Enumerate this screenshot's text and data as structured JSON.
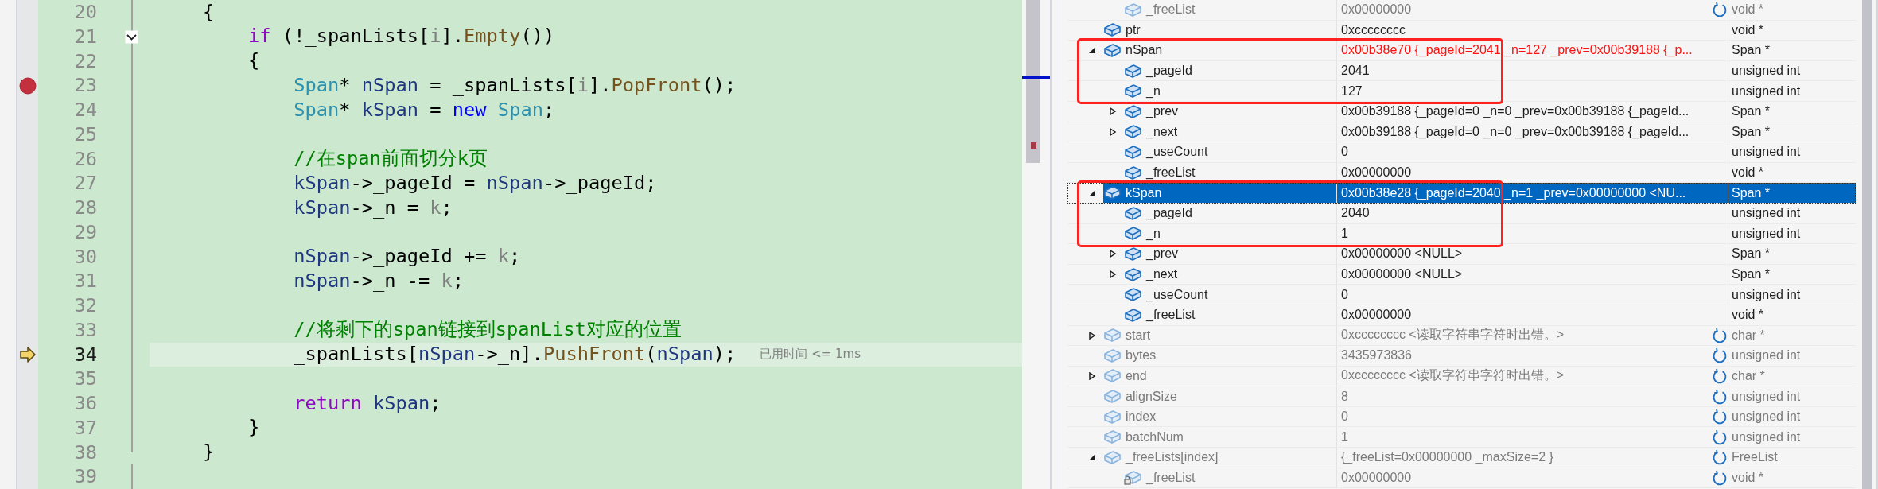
{
  "editor": {
    "lines": [
      {
        "number": "20",
        "breakpoint": false,
        "current": false,
        "foldable": false,
        "tokens": [
          {
            "text": "    {",
            "kind": "plain"
          }
        ]
      },
      {
        "number": "21",
        "breakpoint": false,
        "current": false,
        "foldable": true,
        "tokens": [
          {
            "text": "        if",
            "kind": "keyword"
          },
          {
            "text": " (!_spanLists[",
            "kind": "plain"
          },
          {
            "text": "i",
            "kind": "param"
          },
          {
            "text": "].",
            "kind": "plain"
          },
          {
            "text": "Empty",
            "kind": "function"
          },
          {
            "text": "())",
            "kind": "plain"
          }
        ]
      },
      {
        "number": "22",
        "breakpoint": false,
        "current": false,
        "foldable": false,
        "tokens": [
          {
            "text": "        {",
            "kind": "plain"
          }
        ]
      },
      {
        "number": "23",
        "breakpoint": true,
        "current": false,
        "foldable": false,
        "tokens": [
          {
            "text": "            Span",
            "kind": "type"
          },
          {
            "text": "* ",
            "kind": "plain"
          },
          {
            "text": "nSpan",
            "kind": "local"
          },
          {
            "text": " = _spanLists[",
            "kind": "plain"
          },
          {
            "text": "i",
            "kind": "param"
          },
          {
            "text": "].",
            "kind": "plain"
          },
          {
            "text": "PopFront",
            "kind": "function"
          },
          {
            "text": "();",
            "kind": "plain"
          }
        ]
      },
      {
        "number": "24",
        "breakpoint": false,
        "current": false,
        "foldable": false,
        "tokens": [
          {
            "text": "            Span",
            "kind": "type"
          },
          {
            "text": "* ",
            "kind": "plain"
          },
          {
            "text": "kSpan",
            "kind": "local"
          },
          {
            "text": " = ",
            "kind": "plain"
          },
          {
            "text": "new",
            "kind": "operator-keyword"
          },
          {
            "text": " Span",
            "kind": "type"
          },
          {
            "text": ";",
            "kind": "plain"
          }
        ]
      },
      {
        "number": "25",
        "breakpoint": false,
        "current": false,
        "foldable": false
      },
      {
        "number": "26",
        "breakpoint": false,
        "current": false,
        "foldable": false,
        "tokens": [
          {
            "text": "            //在span前面切分k页",
            "kind": "comment"
          }
        ]
      },
      {
        "number": "27",
        "breakpoint": false,
        "current": false,
        "foldable": false,
        "tokens": [
          {
            "text": "            kSpan",
            "kind": "local"
          },
          {
            "text": "->_pageId = ",
            "kind": "plain"
          },
          {
            "text": "nSpan",
            "kind": "local"
          },
          {
            "text": "->_pageId;",
            "kind": "plain"
          }
        ]
      },
      {
        "number": "28",
        "breakpoint": false,
        "current": false,
        "foldable": false,
        "tokens": [
          {
            "text": "            kSpan",
            "kind": "local"
          },
          {
            "text": "->_n = ",
            "kind": "plain"
          },
          {
            "text": "k",
            "kind": "param"
          },
          {
            "text": ";",
            "kind": "plain"
          }
        ]
      },
      {
        "number": "29",
        "breakpoint": false,
        "current": false,
        "foldable": false
      },
      {
        "number": "30",
        "breakpoint": false,
        "current": false,
        "foldable": false,
        "tokens": [
          {
            "text": "            nSpan",
            "kind": "local"
          },
          {
            "text": "->_pageId += ",
            "kind": "plain"
          },
          {
            "text": "k",
            "kind": "param"
          },
          {
            "text": ";",
            "kind": "plain"
          }
        ]
      },
      {
        "number": "31",
        "breakpoint": false,
        "current": false,
        "foldable": false,
        "tokens": [
          {
            "text": "            nSpan",
            "kind": "local"
          },
          {
            "text": "->_n -= ",
            "kind": "plain"
          },
          {
            "text": "k",
            "kind": "param"
          },
          {
            "text": ";",
            "kind": "plain"
          }
        ]
      },
      {
        "number": "32",
        "breakpoint": false,
        "current": false,
        "foldable": false
      },
      {
        "number": "33",
        "breakpoint": false,
        "current": false,
        "foldable": false,
        "tokens": [
          {
            "text": "            //将剩下的span链接到spanList对应的位置",
            "kind": "comment"
          }
        ]
      },
      {
        "number": "34",
        "breakpoint": false,
        "current": true,
        "foldable": false,
        "hint": "已用时间 <= 1ms",
        "tokens": [
          {
            "text": "            _spanLists[",
            "kind": "plain"
          },
          {
            "text": "nSpan",
            "kind": "local"
          },
          {
            "text": "->_n].",
            "kind": "plain"
          },
          {
            "text": "PushFront",
            "kind": "function"
          },
          {
            "text": "(",
            "kind": "plain"
          },
          {
            "text": "nSpan",
            "kind": "local"
          },
          {
            "text": ");",
            "kind": "plain"
          }
        ]
      },
      {
        "number": "35",
        "breakpoint": false,
        "current": false,
        "foldable": false
      },
      {
        "number": "36",
        "breakpoint": false,
        "current": false,
        "foldable": false,
        "tokens": [
          {
            "text": "            return",
            "kind": "keyword"
          },
          {
            "text": " kSpan",
            "kind": "local"
          },
          {
            "text": ";",
            "kind": "plain"
          }
        ]
      },
      {
        "number": "37",
        "breakpoint": false,
        "current": false,
        "foldable": false,
        "tokens": [
          {
            "text": "        }",
            "kind": "plain"
          }
        ]
      },
      {
        "number": "38",
        "breakpoint": false,
        "current": false,
        "foldable": false,
        "tokens": [
          {
            "text": "    }",
            "kind": "plain"
          }
        ]
      },
      {
        "number": "39",
        "breakpoint": false,
        "current": false,
        "foldable": false
      }
    ]
  },
  "watch": {
    "continued": [
      {
        "name": "_freeList",
        "value": "0x00000000",
        "type": "void *",
        "kind": "member",
        "expandable": false,
        "selected": false,
        "stale": true,
        "changed": false,
        "boxed": false
      }
    ],
    "rows": [
      {
        "name": "ptr",
        "value": "0xcccccccc",
        "type": "void *",
        "kind": "member",
        "expandable": false,
        "selected": false,
        "stale": false,
        "changed": false,
        "boxed": false
      },
      {
        "name": "nSpan",
        "value": "0x00b38e70 {_pageId=2041 _n=127 _prev=0x00b39188 {_p...",
        "type": "Span *",
        "kind": "member",
        "expandable": true,
        "expanded": true,
        "selected": false,
        "stale": false,
        "changed": true,
        "boxed": true,
        "children": [
          {
            "name": "_pageId",
            "value": "2041",
            "type": "unsigned int",
            "kind": "member",
            "expandable": false,
            "selected": false,
            "stale": false,
            "changed": false,
            "boxed": true
          },
          {
            "name": "_n",
            "value": "127",
            "type": "unsigned int",
            "kind": "member",
            "expandable": false,
            "selected": false,
            "stale": false,
            "changed": false,
            "boxed": true
          },
          {
            "name": "_prev",
            "value": "0x00b39188 {_pageId=0 _n=0 _prev=0x00b39188 {_pageId...",
            "type": "Span *",
            "kind": "member",
            "expandable": true,
            "expanded": false,
            "selected": false,
            "stale": false,
            "changed": false,
            "boxed": false
          },
          {
            "name": "_next",
            "value": "0x00b39188 {_pageId=0 _n=0 _prev=0x00b39188 {_pageId...",
            "type": "Span *",
            "kind": "member",
            "expandable": true,
            "expanded": false,
            "selected": false,
            "stale": false,
            "changed": false,
            "boxed": false
          },
          {
            "name": "_useCount",
            "value": "0",
            "type": "unsigned int",
            "kind": "member",
            "expandable": false,
            "selected": false,
            "stale": false,
            "changed": false,
            "boxed": false
          },
          {
            "name": "_freeList",
            "value": "0x00000000",
            "type": "void *",
            "kind": "member",
            "expandable": false,
            "selected": false,
            "stale": false,
            "changed": false,
            "boxed": false
          }
        ]
      },
      {
        "name": "kSpan",
        "value": "0x00b38e28 {_pageId=2040 _n=1 _prev=0x00000000 <NU...",
        "type": "Span *",
        "kind": "member",
        "expandable": true,
        "expanded": true,
        "selected": true,
        "stale": false,
        "changed": false,
        "boxed": true,
        "children": [
          {
            "name": "_pageId",
            "value": "2040",
            "type": "unsigned int",
            "kind": "member",
            "expandable": false,
            "selected": false,
            "stale": false,
            "changed": false,
            "boxed": true
          },
          {
            "name": "_n",
            "value": "1",
            "type": "unsigned int",
            "kind": "member",
            "expandable": false,
            "selected": false,
            "stale": false,
            "changed": false,
            "boxed": true
          },
          {
            "name": "_prev",
            "value": "0x00000000 <NULL>",
            "type": "Span *",
            "kind": "member",
            "expandable": true,
            "expanded": false,
            "selected": false,
            "stale": false,
            "changed": false,
            "boxed": false
          },
          {
            "name": "_next",
            "value": "0x00000000 <NULL>",
            "type": "Span *",
            "kind": "member",
            "expandable": true,
            "expanded": false,
            "selected": false,
            "stale": false,
            "changed": false,
            "boxed": false
          },
          {
            "name": "_useCount",
            "value": "0",
            "type": "unsigned int",
            "kind": "member",
            "expandable": false,
            "selected": false,
            "stale": false,
            "changed": false,
            "boxed": false
          },
          {
            "name": "_freeList",
            "value": "0x00000000",
            "type": "void *",
            "kind": "member",
            "expandable": false,
            "selected": false,
            "stale": false,
            "changed": false,
            "boxed": false
          }
        ]
      },
      {
        "name": "start",
        "value": "0xcccccccc <读取字符串字符时出错。>",
        "type": "char *",
        "kind": "member",
        "expandable": true,
        "expanded": false,
        "selected": false,
        "stale": true,
        "changed": false,
        "boxed": false
      },
      {
        "name": "bytes",
        "value": "3435973836",
        "type": "unsigned int",
        "kind": "member",
        "expandable": false,
        "selected": false,
        "stale": true,
        "changed": false,
        "boxed": false
      },
      {
        "name": "end",
        "value": "0xcccccccc <读取字符串字符时出错。>",
        "type": "char *",
        "kind": "member",
        "expandable": true,
        "expanded": false,
        "selected": false,
        "stale": true,
        "changed": false,
        "boxed": false
      },
      {
        "name": "alignSize",
        "value": "8",
        "type": "unsigned int",
        "kind": "member",
        "expandable": false,
        "selected": false,
        "stale": true,
        "changed": false,
        "boxed": false
      },
      {
        "name": "index",
        "value": "0",
        "type": "unsigned int",
        "kind": "member",
        "expandable": false,
        "selected": false,
        "stale": true,
        "changed": false,
        "boxed": false
      },
      {
        "name": "batchNum",
        "value": "1",
        "type": "unsigned int",
        "kind": "member",
        "expandable": false,
        "selected": false,
        "stale": true,
        "changed": false,
        "boxed": false
      },
      {
        "name": "_freeLists[index]",
        "value": "{_freeList=0x00000000 _maxSize=2 }",
        "type": "FreeList",
        "kind": "member",
        "expandable": true,
        "expanded": true,
        "selected": false,
        "stale": true,
        "changed": false,
        "boxed": false,
        "children": [
          {
            "name": "_freeList",
            "value": "0x00000000",
            "type": "void *",
            "kind": "private-member",
            "expandable": false,
            "selected": false,
            "stale": true,
            "changed": false,
            "boxed": false
          }
        ]
      }
    ]
  }
}
